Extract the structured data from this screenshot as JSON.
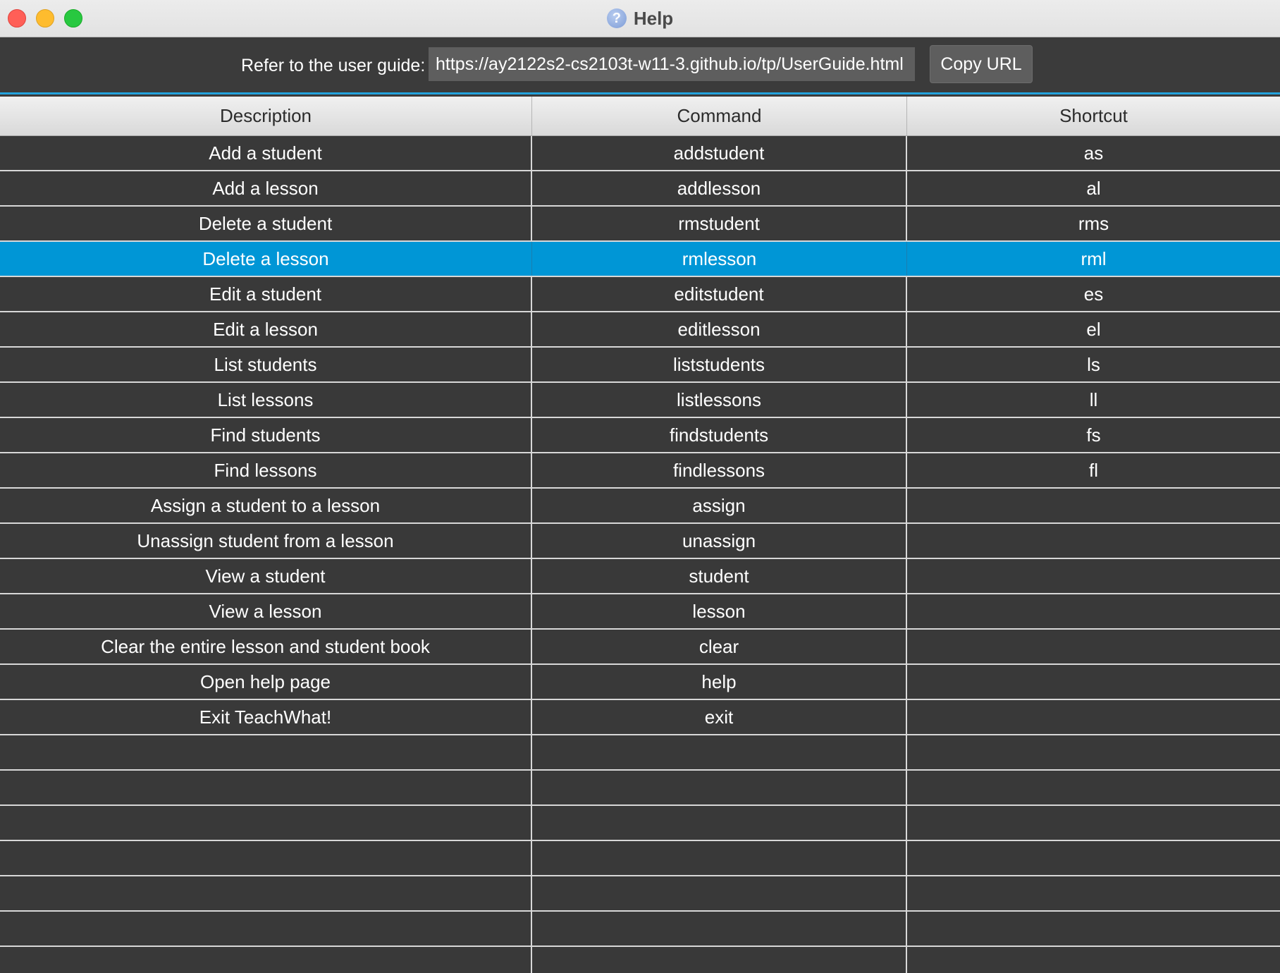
{
  "window": {
    "title": "Help",
    "icon": "question-circle-icon"
  },
  "guide": {
    "label": "Refer to the user guide:",
    "url": "https://ay2122s2-cs2103t-w11-3.github.io/tp/UserGuide.html",
    "copy_button": "Copy URL"
  },
  "table": {
    "columns": [
      "Description",
      "Command",
      "Shortcut"
    ],
    "selected_index": 3,
    "rows": [
      {
        "description": "Add a student",
        "command": "addstudent",
        "shortcut": "as"
      },
      {
        "description": "Add a lesson",
        "command": "addlesson",
        "shortcut": "al"
      },
      {
        "description": "Delete a student",
        "command": "rmstudent",
        "shortcut": "rms"
      },
      {
        "description": "Delete a lesson",
        "command": "rmlesson",
        "shortcut": "rml"
      },
      {
        "description": "Edit a student",
        "command": "editstudent",
        "shortcut": "es"
      },
      {
        "description": "Edit a lesson",
        "command": "editlesson",
        "shortcut": "el"
      },
      {
        "description": "List students",
        "command": "liststudents",
        "shortcut": "ls"
      },
      {
        "description": "List lessons",
        "command": "listlessons",
        "shortcut": "ll"
      },
      {
        "description": "Find students",
        "command": "findstudents",
        "shortcut": "fs"
      },
      {
        "description": "Find lessons",
        "command": "findlessons",
        "shortcut": "fl"
      },
      {
        "description": "Assign a student to a lesson",
        "command": "assign",
        "shortcut": ""
      },
      {
        "description": "Unassign student from a lesson",
        "command": "unassign",
        "shortcut": ""
      },
      {
        "description": "View a student",
        "command": "student",
        "shortcut": ""
      },
      {
        "description": "View a lesson",
        "command": "lesson",
        "shortcut": ""
      },
      {
        "description": "Clear the entire lesson and student book",
        "command": "clear",
        "shortcut": ""
      },
      {
        "description": "Open help page",
        "command": "help",
        "shortcut": ""
      },
      {
        "description": "Exit TeachWhat!",
        "command": "exit",
        "shortcut": ""
      },
      {
        "description": "",
        "command": "",
        "shortcut": ""
      },
      {
        "description": "",
        "command": "",
        "shortcut": ""
      },
      {
        "description": "",
        "command": "",
        "shortcut": ""
      },
      {
        "description": "",
        "command": "",
        "shortcut": ""
      },
      {
        "description": "",
        "command": "",
        "shortcut": ""
      },
      {
        "description": "",
        "command": "",
        "shortcut": ""
      },
      {
        "description": "",
        "command": "",
        "shortcut": ""
      },
      {
        "description": "",
        "command": "",
        "shortcut": ""
      }
    ]
  },
  "colors": {
    "background": "#3b3b3b",
    "selection": "#0096d6",
    "accent_line": "#22a2dc",
    "close": "#ff5f57",
    "minimize": "#febc2e",
    "zoom": "#28c840"
  }
}
